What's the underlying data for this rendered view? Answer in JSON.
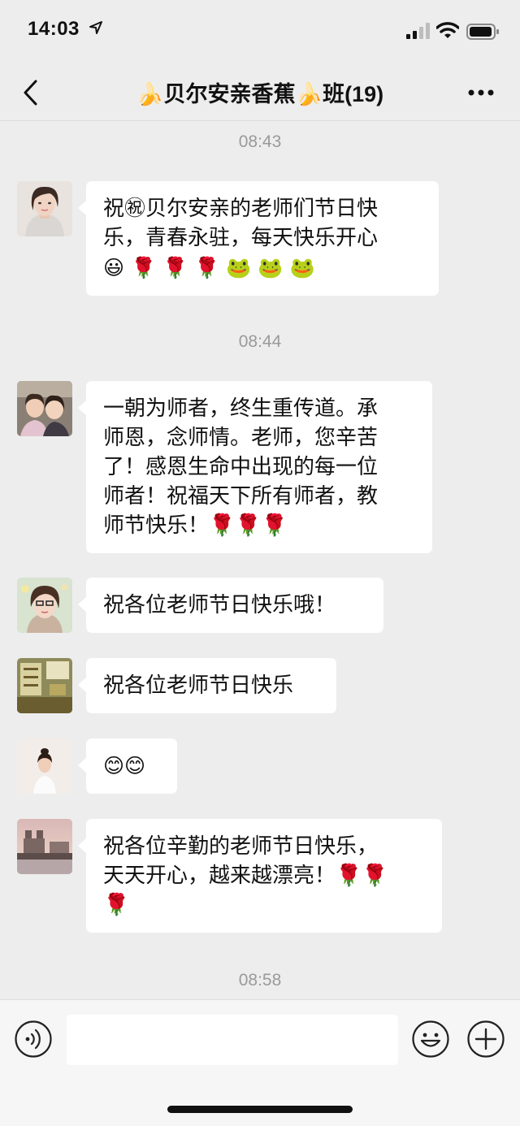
{
  "status": {
    "time": "14:03"
  },
  "header": {
    "title": "🍌贝尔安亲香蕉🍌班(19)"
  },
  "chat": {
    "timestamps": [
      "08:43",
      "08:44",
      "08:58"
    ],
    "messages": [
      {
        "lines": [
          "祝㊗贝尔安亲的老师们节日快",
          "乐，青春永驻，每天快乐开心"
        ],
        "emoji_line": [
          "😃",
          "🌹",
          "🌹",
          "🌹",
          "🐸",
          "🐸",
          "🐸"
        ]
      },
      {
        "lines": [
          "一朝为师者，终生重传道。承",
          "师恩，念师情。老师，您辛苦",
          "了！感恩生命中出现的每一位",
          "师者！祝福天下所有师者，教",
          "师节快乐！🌹🌹🌹"
        ]
      },
      {
        "lines": [
          "祝各位老师节日快乐哦！"
        ]
      },
      {
        "lines": [
          "祝各位老师节日快乐"
        ]
      },
      {
        "lines": [
          "😊😊"
        ]
      },
      {
        "lines": [
          "祝各位辛勤的老师节日快乐，",
          "天天开心，越来越漂亮！🌹🌹",
          "🌹"
        ]
      }
    ]
  },
  "input": {
    "value": ""
  },
  "colors": {
    "background": "#ededed",
    "bubble": "#ffffff",
    "timestamp": "#9a9a9a"
  },
  "icons": [
    "location-arrow-icon",
    "signal-icon",
    "wifi-icon",
    "battery-icon",
    "back-chevron-icon",
    "more-dots-icon",
    "voice-icon",
    "emoji-icon",
    "plus-icon"
  ]
}
